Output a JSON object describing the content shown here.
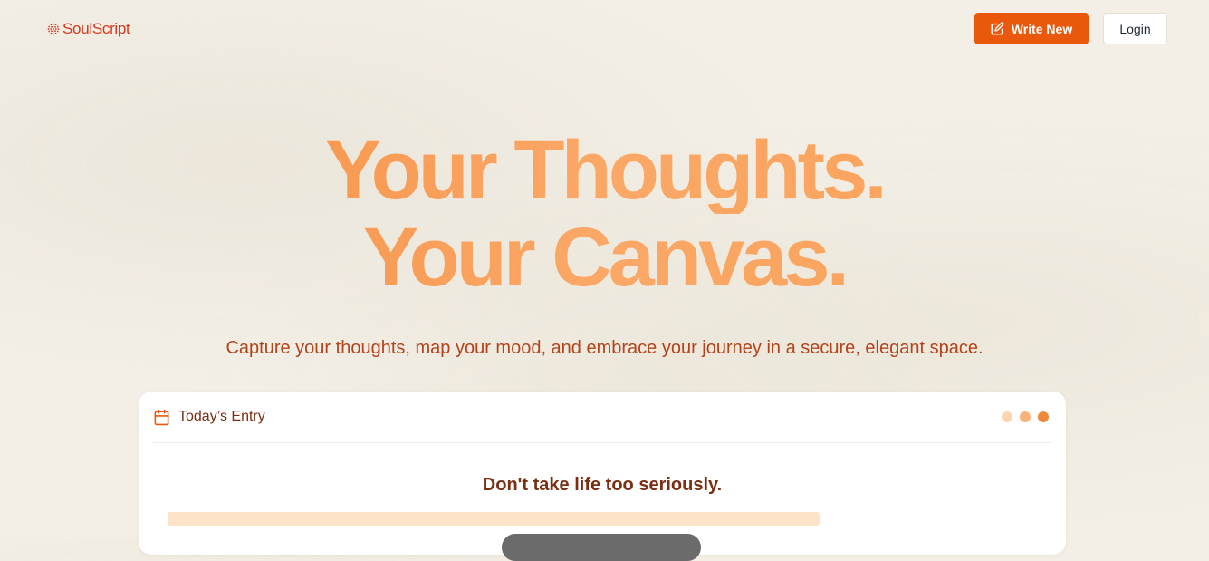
{
  "nav": {
    "logo_text": "SoulScript",
    "logo_icon": "dotted-circle-icon",
    "write_label": "Write New",
    "write_icon": "edit-icon",
    "login_label": "Login"
  },
  "hero": {
    "title_line1": "Your Thoughts.",
    "title_line2": "Your Canvas.",
    "subtitle": "Capture your thoughts, map your mood, and embrace your journey in a secure, elegant space."
  },
  "entry_card": {
    "title": "Today’s Entry",
    "title_icon": "calendar-icon",
    "quote": "Don't take life too seriously.",
    "dot_colors": [
      "#fdd5b0",
      "#f9b37a",
      "#f08a3a"
    ]
  },
  "colors": {
    "brand": "#d9381e",
    "accent": "#ea580c",
    "title_gradient": [
      "#f4893a",
      "#fba867",
      "#f7a055"
    ],
    "text_brown": "#7a2e12",
    "subtitle": "#b3431a"
  }
}
